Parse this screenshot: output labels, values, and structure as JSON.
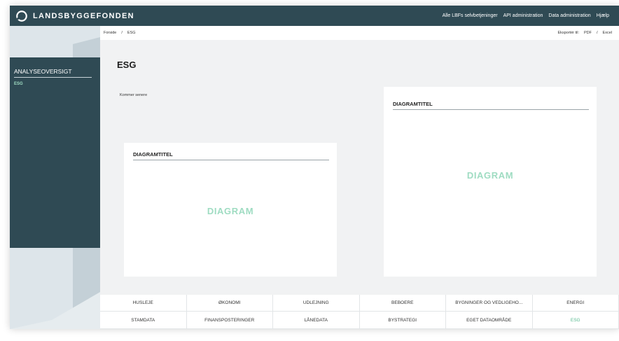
{
  "brand": {
    "name": "LANDSBYGGEFONDEN"
  },
  "topnav": [
    {
      "label": "Alle LBFs selvbetjeninger"
    },
    {
      "label": "API administration"
    },
    {
      "label": "Data administration"
    },
    {
      "label": "Hjælp"
    }
  ],
  "breadcrumb": {
    "home": "Forside",
    "separator": "/",
    "current": "ESG"
  },
  "export": {
    "label": "Eksportér til:",
    "pdf": "PDF",
    "separator": "/",
    "excel": "Excel"
  },
  "sidebar": {
    "title": "ANALYSEOVERSIGT",
    "items": [
      {
        "label": "ESG",
        "active": true
      }
    ]
  },
  "page": {
    "title": "ESG",
    "note": "Kommer senere"
  },
  "cards": [
    {
      "title": "DIAGRAMTITEL",
      "placeholder": "DIAGRAM"
    },
    {
      "title": "DIAGRAMTITEL",
      "placeholder": "DIAGRAM"
    }
  ],
  "tabs": [
    {
      "label": "HUSLEJE"
    },
    {
      "label": "ØKONOMI"
    },
    {
      "label": "UDLEJNING"
    },
    {
      "label": "BEBOERE"
    },
    {
      "label": "BYGNINGER OG VEDLIGEHO..."
    },
    {
      "label": "ENERGI"
    },
    {
      "label": "STAMDATA"
    },
    {
      "label": "FINANSPOSTERINGER"
    },
    {
      "label": "LÅNEDATA"
    },
    {
      "label": "BYSTRATEGI"
    },
    {
      "label": "EGET DATAOMRÅDE"
    },
    {
      "label": "ESG",
      "active": true
    }
  ],
  "colors": {
    "header": "#2f4a54",
    "accent": "#9fdcc2",
    "active_tab": "#56b98f",
    "background": "#f1f2f3"
  }
}
